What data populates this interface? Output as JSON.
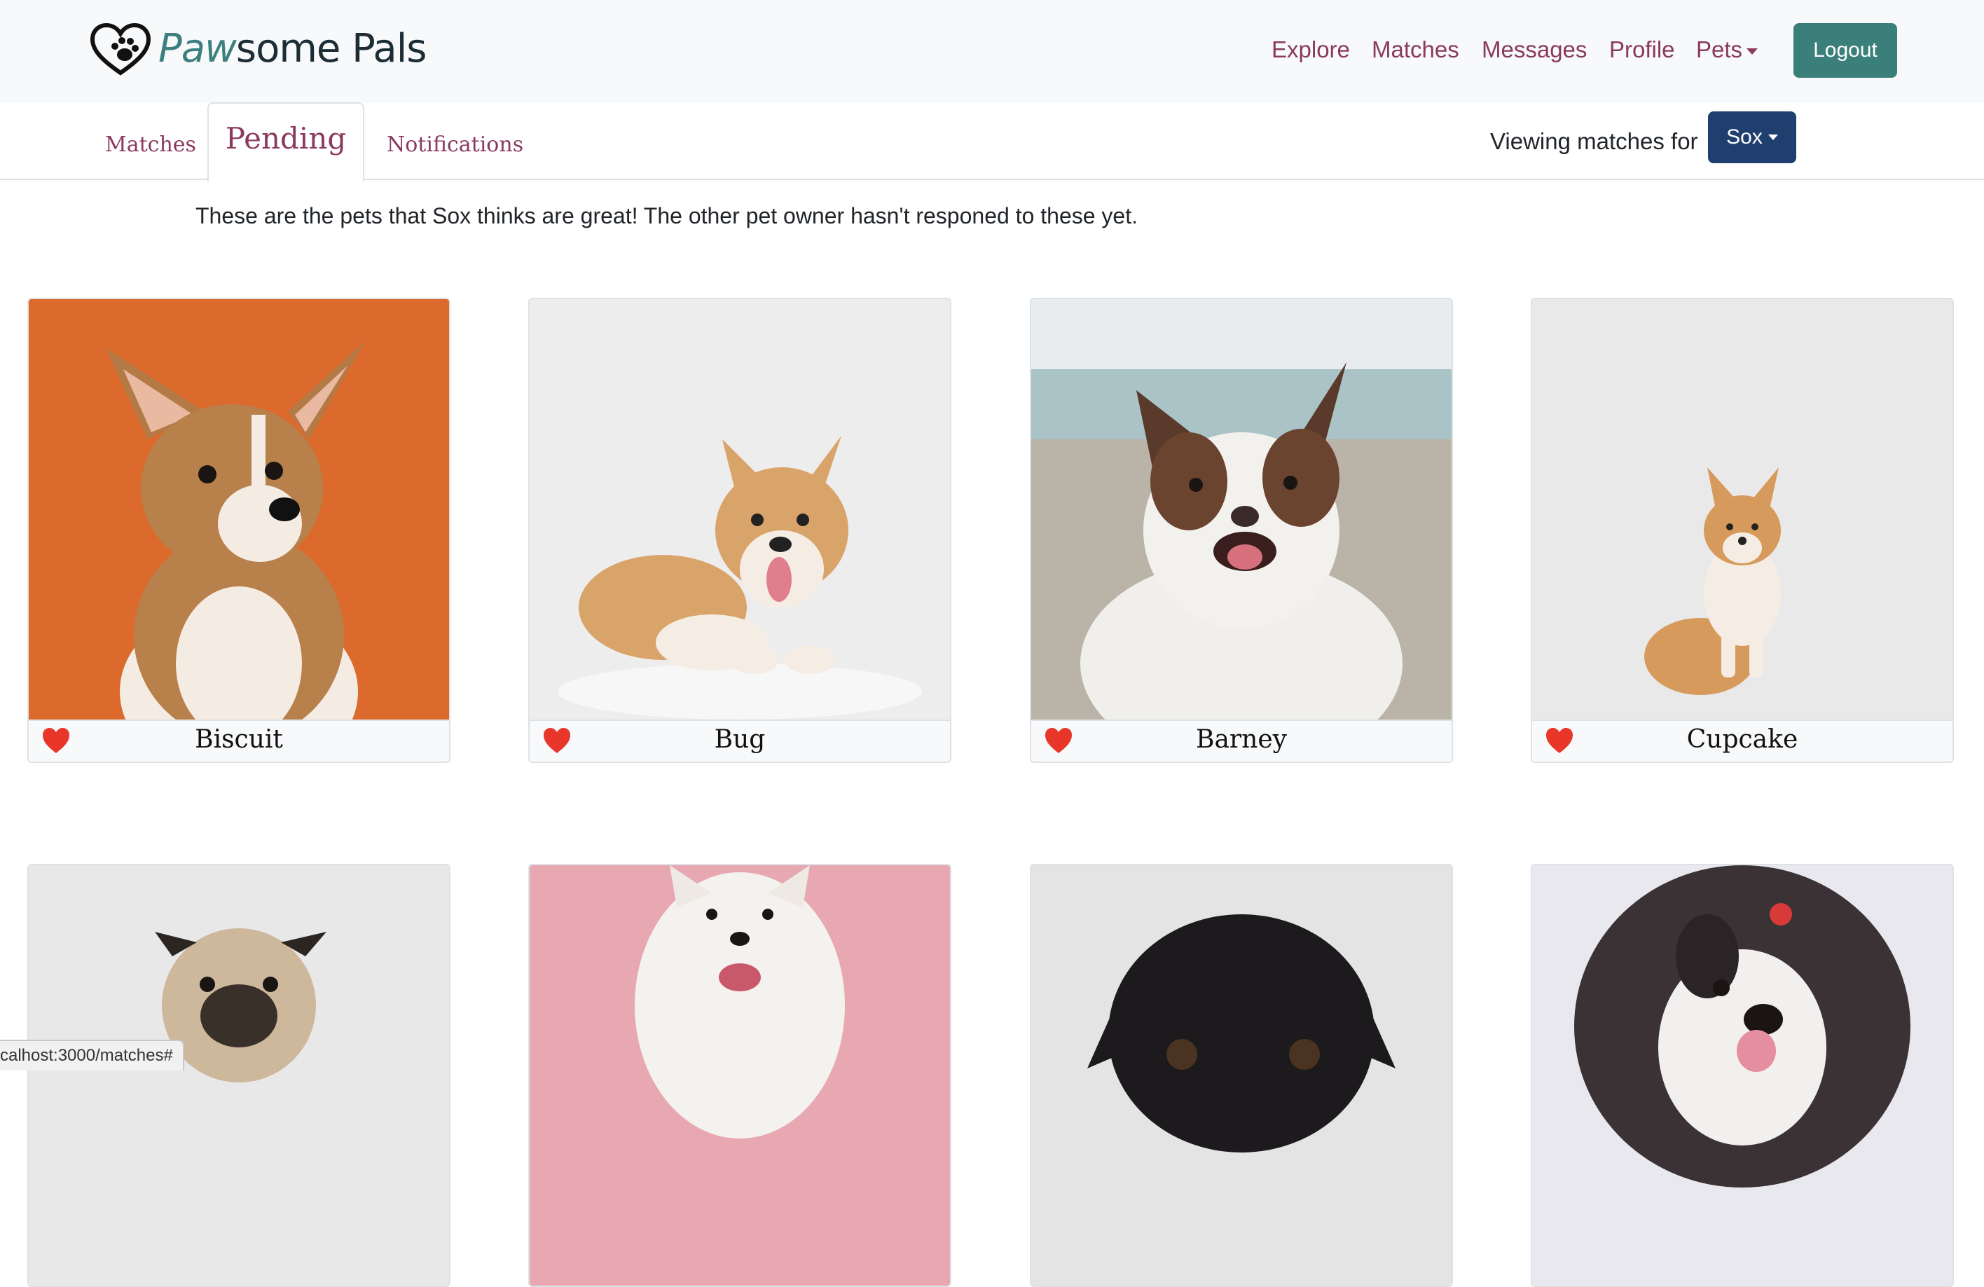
{
  "brand": {
    "prefix": "Paw",
    "suffix": "some Pals"
  },
  "nav": {
    "explore": "Explore",
    "matches": "Matches",
    "messages": "Messages",
    "profile": "Profile",
    "pets": "Pets",
    "logout": "Logout"
  },
  "tabs": {
    "matches": "Matches",
    "pending": "Pending",
    "notifications": "Notifications"
  },
  "viewing": {
    "label": "Viewing matches for",
    "pet": "Sox"
  },
  "intro": "These are the pets that Sox thinks are great! The other pet owner hasn't responed to these yet.",
  "pets": [
    {
      "name": "Biscuit"
    },
    {
      "name": "Bug"
    },
    {
      "name": "Barney"
    },
    {
      "name": "Cupcake"
    }
  ],
  "status_url": "calhost:3000/matches#",
  "colors": {
    "accent": "#3b7f7a",
    "link": "#8a3a5e",
    "sox_button": "#1f3f6e",
    "heart": "#e8372a"
  }
}
